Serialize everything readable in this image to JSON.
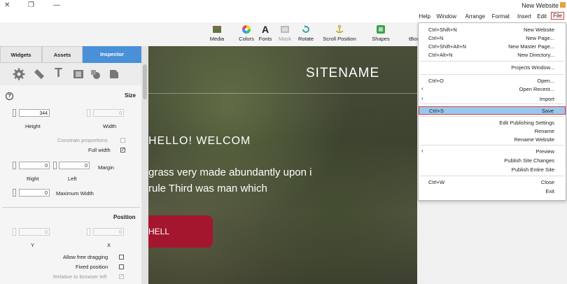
{
  "window": {
    "title": "New Website",
    "controls": {
      "close": "✕",
      "maximize": "❐",
      "minimize": "—"
    }
  },
  "menubar": {
    "file": "File",
    "edit": "Edit",
    "insert": "Insert",
    "format": "Format",
    "arrange": "Arrange",
    "window": "Window",
    "help": "Help"
  },
  "toolbar": {
    "media": "Media",
    "colors": "Colors",
    "fonts": "Fonts",
    "mask": "Mask",
    "rotate": "Rotate",
    "scroll_position": "Scroll Position",
    "shapes": "Shapes",
    "textbox": "tBox"
  },
  "panel": {
    "tabs": {
      "inspector": "Inspector",
      "assets": "Assets",
      "widgets": "Widgets"
    },
    "size": {
      "title": "Size",
      "width_label": "Width",
      "width_value": "0",
      "height_label": "Height",
      "height_value": "344",
      "constrain": "Constrain proportions",
      "full_width": "Full width",
      "margin_label": "Margin",
      "left_label": "Left",
      "left_value": "0",
      "right_label": "Right",
      "right_value": "0",
      "max_width_label": "Maximum Width",
      "max_width_value": "0"
    },
    "position": {
      "title": "Position",
      "x_label": "X",
      "x_value": "0",
      "y_label": "Y",
      "y_value": "0",
      "allow_free": "Allow free dragging",
      "fixed": "Fixed position",
      "relative": "Relative to browser left"
    }
  },
  "canvas": {
    "sitename": "SITENAME",
    "hello": "HELLO!  WELCOM",
    "body_line1": "grass very made abundantly upon i",
    "body_line2": "rule Third was man which",
    "button": "HELL"
  },
  "filemenu": {
    "items": [
      {
        "label": "New Website",
        "shortcut": "Ctrl+Shift+N"
      },
      {
        "label": "New Page...",
        "shortcut": "Ctrl+N"
      },
      {
        "label": "New Master Page...",
        "shortcut": "Ctrl+Shift+Alt+N"
      },
      {
        "label": "New Directory...",
        "shortcut": "Ctrl+Alt+N"
      },
      {
        "label": "Projects Window...",
        "shortcut": ""
      },
      {
        "label": "Open...",
        "shortcut": "Ctrl+O"
      },
      {
        "label": "Open Recent...",
        "shortcut": ""
      },
      {
        "label": "Import",
        "shortcut": ""
      },
      {
        "label": "Save",
        "shortcut": "Ctrl+S"
      },
      {
        "label": "Edit Publishing Settings",
        "shortcut": ""
      },
      {
        "label": "Rename",
        "shortcut": ""
      },
      {
        "label": "Rename Website",
        "shortcut": ""
      },
      {
        "label": "Preview",
        "shortcut": ""
      },
      {
        "label": "Publish Site Changes",
        "shortcut": ""
      },
      {
        "label": "Publish Entire Site",
        "shortcut": ""
      },
      {
        "label": "Close",
        "shortcut": "Ctrl+W"
      },
      {
        "label": "Exit",
        "shortcut": ""
      }
    ]
  },
  "colors": {
    "accent": "#4a90d9",
    "save_highlight": "#99c8ee",
    "red_outline": "#d83b3b",
    "hero_button": "#a3162e"
  }
}
